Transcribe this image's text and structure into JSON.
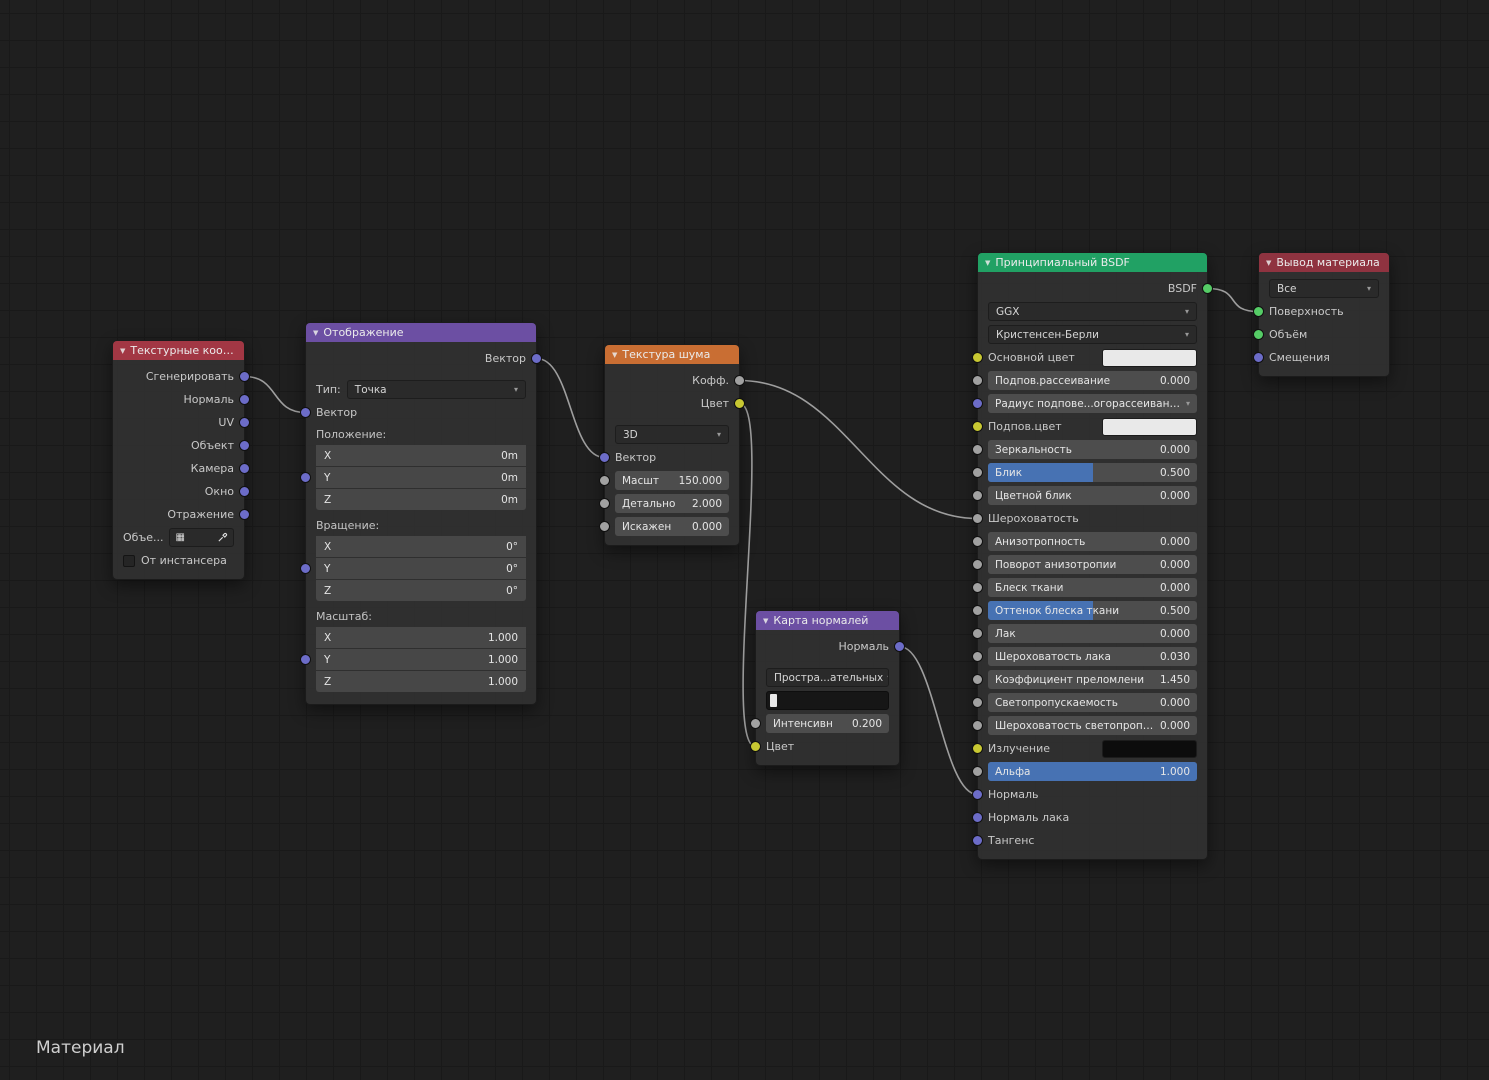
{
  "editor": {
    "label": "Материал"
  },
  "colors": {
    "header_input": "#a23744",
    "header_output": "#8f3340",
    "header_vector": "#6c4fa3",
    "header_texture": "#c96e33",
    "header_shader": "#21a164",
    "socket_vector": "#6c6cc8",
    "socket_color": "#c8c832",
    "socket_float": "#a1a1a1",
    "socket_shader": "#55cc66",
    "accent": "#4772b3",
    "noodle": "#9e9e9e"
  },
  "tex_coord": {
    "title": "Текстурные коорд...",
    "outputs": [
      {
        "label": "Сгенерировать"
      },
      {
        "label": "Нормаль"
      },
      {
        "label": "UV"
      },
      {
        "label": "Объект"
      },
      {
        "label": "Камера"
      },
      {
        "label": "Окно"
      },
      {
        "label": "Отражение"
      }
    ],
    "object_label": "Объе...",
    "instancer_label": "От инстансера"
  },
  "mapping": {
    "title": "Отображение",
    "output_label": "Вектор",
    "type_label": "Тип:",
    "type_value": "Точка",
    "vector_label": "Вектор",
    "groups": [
      {
        "label": "Положение:",
        "rows": [
          {
            "axis": "X",
            "value": "0m"
          },
          {
            "axis": "Y",
            "value": "0m"
          },
          {
            "axis": "Z",
            "value": "0m"
          }
        ]
      },
      {
        "label": "Вращение:",
        "rows": [
          {
            "axis": "X",
            "value": "0°"
          },
          {
            "axis": "Y",
            "value": "0°"
          },
          {
            "axis": "Z",
            "value": "0°"
          }
        ]
      },
      {
        "label": "Масштаб:",
        "rows": [
          {
            "axis": "X",
            "value": "1.000"
          },
          {
            "axis": "Y",
            "value": "1.000"
          },
          {
            "axis": "Z",
            "value": "1.000"
          }
        ]
      }
    ]
  },
  "noise": {
    "title": "Текстура шума",
    "outputs": [
      {
        "label": "Кофф."
      },
      {
        "label": "Цвет"
      }
    ],
    "dimensions": "3D",
    "vector_label": "Вектор",
    "sliders": [
      {
        "label": "Масшт",
        "value": "150.000"
      },
      {
        "label": "Детально",
        "value": "2.000"
      },
      {
        "label": "Искажен",
        "value": "0.000"
      }
    ]
  },
  "normal_map": {
    "title": "Карта нормалей",
    "output_label": "Нормаль",
    "space_value": "Простра...ательных",
    "strength": {
      "label": "Интенсивн",
      "value": "0.200"
    },
    "color_label": "Цвет"
  },
  "bsdf": {
    "title": "Принципиальный BSDF",
    "output_label": "BSDF",
    "distribution": "GGX",
    "subsurface_method": "Кристенсен-Берли",
    "rows": [
      {
        "label": "Основной цвет",
        "swatch": "#e9e9e9"
      },
      {
        "label": "Подпов.рассеивание",
        "value": "0.000"
      },
      {
        "label": "Радиус подпове...огорассеивания"
      },
      {
        "label": "Подпов.цвет",
        "swatch": "#e9e9e9"
      },
      {
        "label": "Зеркальность",
        "value": "0.000"
      },
      {
        "label": "Блик",
        "value": "0.500",
        "fill_pct": 50
      },
      {
        "label": "Цветной блик",
        "value": "0.000"
      },
      {
        "label": "Шероховатость"
      },
      {
        "label": "Анизотропность",
        "value": "0.000"
      },
      {
        "label": "Поворот анизотропии",
        "value": "0.000"
      },
      {
        "label": "Блеск ткани",
        "value": "0.000"
      },
      {
        "label": "Оттенок блеска ткани",
        "value": "0.500",
        "fill_pct": 50
      },
      {
        "label": "Лак",
        "value": "0.000"
      },
      {
        "label": "Шероховатость лака",
        "value": "0.030"
      },
      {
        "label": "Коэффициент преломлени",
        "value": "1.450"
      },
      {
        "label": "Светопропускаемость",
        "value": "0.000"
      },
      {
        "label": "Шероховатость светопропуска",
        "value": "0.000"
      },
      {
        "label": "Излучение",
        "swatch": "#0c0c0c"
      },
      {
        "label": "Альфа",
        "value": "1.000",
        "fill_pct": 100
      },
      {
        "label": "Нормаль"
      },
      {
        "label": "Нормаль лака"
      },
      {
        "label": "Тангенс"
      }
    ]
  },
  "output_node": {
    "title": "Вывод материала",
    "target": "Все",
    "inputs": [
      {
        "label": "Поверхность"
      },
      {
        "label": "Объём"
      },
      {
        "label": "Смещения"
      }
    ]
  },
  "links": [
    {
      "from": "texcoord-generated",
      "to": "mapping-vector-in"
    },
    {
      "from": "mapping-vector-out",
      "to": "noise-vector-in"
    },
    {
      "from": "noise-fac-out",
      "to": "bsdf-roughness-in"
    },
    {
      "from": "noise-color-out",
      "to": "normalmap-color-in"
    },
    {
      "from": "normalmap-normal-out",
      "to": "bsdf-normal-in"
    },
    {
      "from": "bsdf-out",
      "to": "output-surface-in"
    }
  ]
}
